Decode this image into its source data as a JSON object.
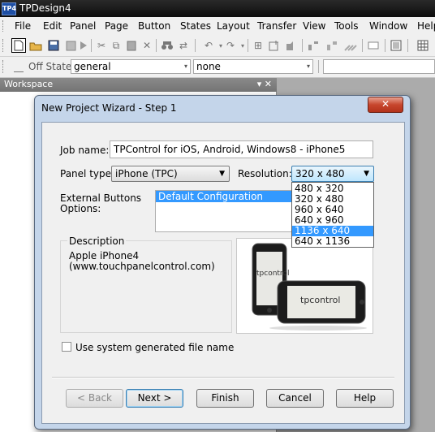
{
  "app": {
    "logo": "TP4",
    "title": "TPDesign4"
  },
  "menu": [
    "File",
    "Edit",
    "Panel",
    "Page",
    "Button",
    "States",
    "Layout",
    "Transfer",
    "View",
    "Tools",
    "Window",
    "Help"
  ],
  "statebar": {
    "state_label": "Off State",
    "combo1_value": "general",
    "combo2_value": "none"
  },
  "workspace": {
    "title": "Workspace",
    "controls": "▾ ✕"
  },
  "dialog": {
    "title": "New Project Wizard - Step 1",
    "close_glyph": "✕",
    "job_name_label": "Job name:",
    "job_name_value": "TPControl for iOS, Android, Windows8 - iPhone5",
    "panel_type_label": "Panel type:",
    "panel_type_value": "iPhone (TPC)",
    "resolution_label": "Resolution:",
    "resolution_value": "320 x 480",
    "resolution_options": [
      "480 x 320",
      "320 x 480",
      "960 x 640",
      "640 x 960",
      "1136 x 640",
      "640 x 1136"
    ],
    "resolution_highlighted": "1136 x 640",
    "ext_buttons_label_1": "External Buttons",
    "ext_buttons_label_2": "Options:",
    "ext_buttons_selected": "Default Configuration",
    "description_label": "Description",
    "description_line1": "Apple iPhone4",
    "description_line2": "(www.touchpanelcontrol.com)",
    "device_logo_text": "tpcontrol",
    "checkbox_label": "Use system generated file name",
    "buttons": {
      "back": "< Back",
      "next": "Next >",
      "finish": "Finish",
      "cancel": "Cancel",
      "help": "Help"
    }
  }
}
